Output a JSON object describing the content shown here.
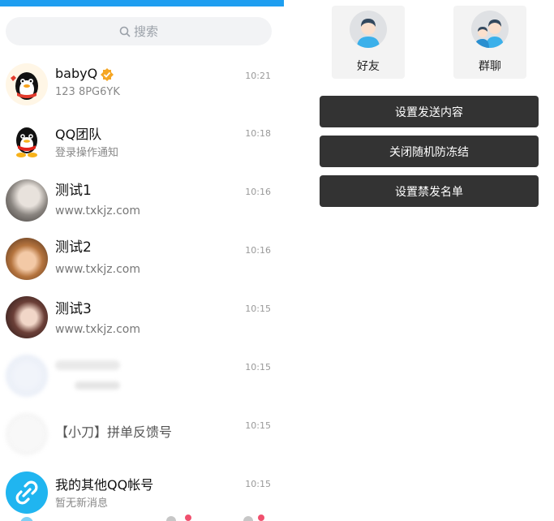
{
  "search": {
    "placeholder": "搜索"
  },
  "chats": [
    {
      "name": "babyQ",
      "sub": "123 8PG6YK",
      "time": "10:21",
      "verified": true
    },
    {
      "name": "QQ团队",
      "sub": "登录操作通知",
      "time": "10:18"
    },
    {
      "name": "测试1",
      "sub": "www.txkjz.com",
      "time": "10:16"
    },
    {
      "name": "测试2",
      "sub": "www.txkjz.com",
      "time": "10:16"
    },
    {
      "name": "测试3",
      "sub": "www.txkjz.com",
      "time": "10:15"
    },
    {
      "name": "",
      "sub": "",
      "time": "10:15"
    },
    {
      "name": "【小刀】拼单反馈号",
      "sub": "",
      "time": "10:15"
    },
    {
      "name": "我的其他QQ帐号",
      "sub": "暂无新消息",
      "time": "10:15"
    }
  ],
  "right_panel": {
    "tiles": [
      {
        "label": "好友",
        "icon": "person-icon"
      },
      {
        "label": "群聊",
        "icon": "group-icon"
      }
    ],
    "buttons": [
      {
        "label": "设置发送内容"
      },
      {
        "label": "关闭随机防冻结"
      },
      {
        "label": "设置禁发名单"
      }
    ]
  },
  "colors": {
    "accent": "#1e9ef0",
    "button_bg": "#333333",
    "verified": "#f5a623"
  }
}
